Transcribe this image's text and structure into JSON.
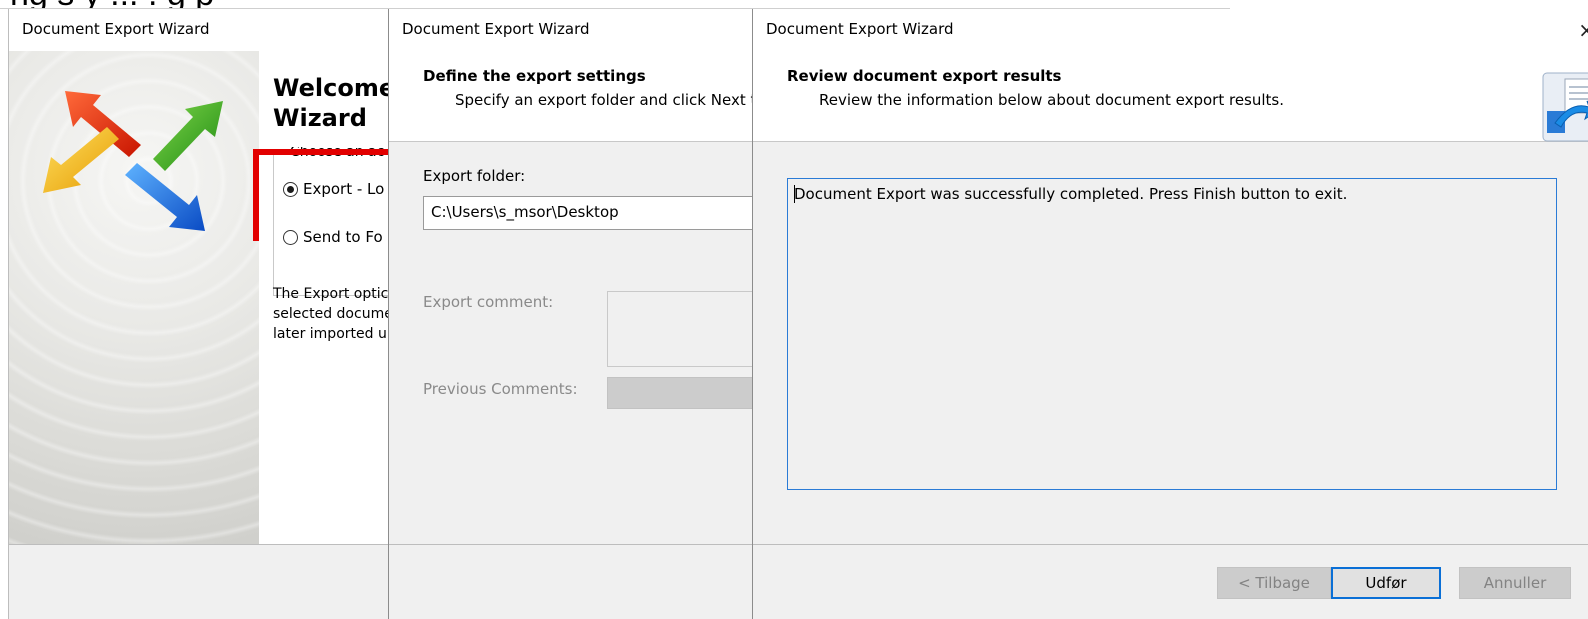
{
  "caption": "ng s y            ...    . g    p",
  "windows": {
    "welcome": {
      "title": "Document Export Wizard",
      "heading_line1": "Welcome",
      "heading_line2": "Wizard",
      "group_label": "Choose an ac",
      "option_export": "Export - Lo",
      "option_send": "Send to Fo",
      "description": [
        "The Export optic",
        "selected docume",
        "later imported u"
      ]
    },
    "settings": {
      "title": "Document Export Wizard",
      "header_title": "Define the export settings",
      "header_sub": "Specify an export folder and click Next to",
      "export_folder_label": "Export folder:",
      "export_folder_value": "C:\\Users\\s_msor\\Desktop",
      "export_comment_label": "Export comment:",
      "previous_comments_label": "Previous Comments:"
    },
    "results": {
      "title": "Document Export Wizard",
      "close_glyph": "×",
      "header_title": "Review document export results",
      "header_sub": "Review the information below about document export results.",
      "results_text": "Document Export was successfully completed. Press Finish button to exit.",
      "buttons": {
        "back": "< Tilbage",
        "finish": "Udfør",
        "cancel": "Annuller"
      }
    }
  },
  "colors": {
    "accent": "#0a6fd6",
    "highlight": "#e20000"
  },
  "icons": {
    "wizard_logo": "four-arrows-icon",
    "export_icon": "document-export-icon"
  }
}
